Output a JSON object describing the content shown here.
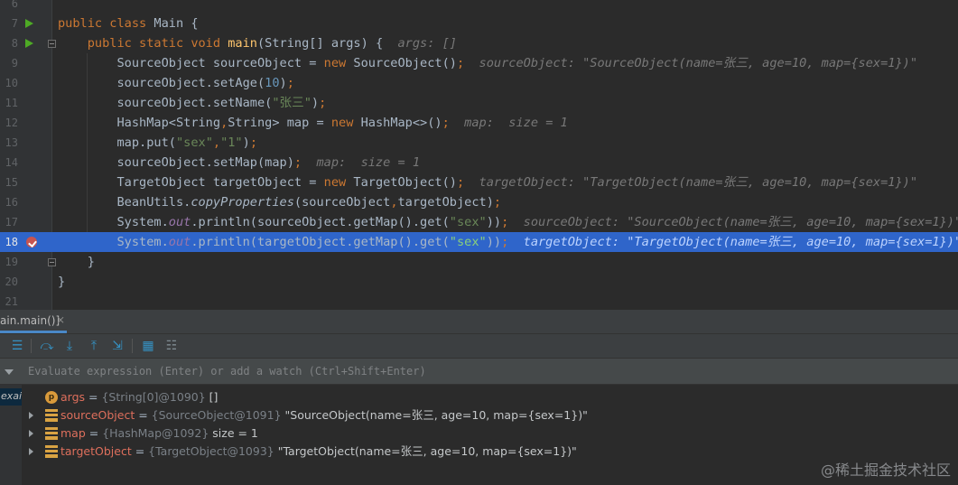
{
  "editor": {
    "lines": [
      {
        "n": "6",
        "tokens": []
      },
      {
        "n": "7",
        "tokens": [
          {
            "t": "public class ",
            "c": "kw"
          },
          {
            "t": "Main {",
            "c": ""
          }
        ]
      },
      {
        "n": "8",
        "tokens": [
          {
            "t": "    public static void ",
            "c": "kw"
          },
          {
            "t": "main",
            "c": "fn"
          },
          {
            "t": "(String[] args) {  ",
            "c": ""
          },
          {
            "t": "args: []",
            "c": "inl"
          }
        ]
      },
      {
        "n": "9",
        "tokens": [
          {
            "t": "        SourceObject sourceObject = ",
            "c": ""
          },
          {
            "t": "new ",
            "c": "kw"
          },
          {
            "t": "SourceObject()",
            "c": ""
          },
          {
            "t": ";",
            "c": "kw"
          },
          {
            "t": "  sourceObject: \"SourceObject(name=张三, age=10, map={sex=1})\"",
            "c": "inl"
          }
        ]
      },
      {
        "n": "10",
        "tokens": [
          {
            "t": "        sourceObject.setAge(",
            "c": ""
          },
          {
            "t": "10",
            "c": "num"
          },
          {
            "t": ")",
            "c": ""
          },
          {
            "t": ";",
            "c": "kw"
          }
        ]
      },
      {
        "n": "11",
        "tokens": [
          {
            "t": "        sourceObject.setName(",
            "c": ""
          },
          {
            "t": "\"张三\"",
            "c": "str"
          },
          {
            "t": ")",
            "c": ""
          },
          {
            "t": ";",
            "c": "kw"
          }
        ]
      },
      {
        "n": "12",
        "tokens": [
          {
            "t": "        HashMap<String",
            "c": ""
          },
          {
            "t": ",",
            "c": "kw"
          },
          {
            "t": "String> map = ",
            "c": ""
          },
          {
            "t": "new ",
            "c": "kw"
          },
          {
            "t": "HashMap<>()",
            "c": ""
          },
          {
            "t": ";",
            "c": "kw"
          },
          {
            "t": "  map:  size = 1",
            "c": "inl"
          }
        ]
      },
      {
        "n": "13",
        "tokens": [
          {
            "t": "        map.put(",
            "c": ""
          },
          {
            "t": "\"sex\"",
            "c": "str"
          },
          {
            "t": ",",
            "c": "kw"
          },
          {
            "t": "\"1\"",
            "c": "str"
          },
          {
            "t": ")",
            "c": ""
          },
          {
            "t": ";",
            "c": "kw"
          }
        ]
      },
      {
        "n": "14",
        "tokens": [
          {
            "t": "        sourceObject.setMap(map)",
            "c": ""
          },
          {
            "t": ";",
            "c": "kw"
          },
          {
            "t": "  map:  size = 1",
            "c": "inl"
          }
        ]
      },
      {
        "n": "15",
        "tokens": [
          {
            "t": "        TargetObject targetObject = ",
            "c": ""
          },
          {
            "t": "new ",
            "c": "kw"
          },
          {
            "t": "TargetObject()",
            "c": ""
          },
          {
            "t": ";",
            "c": "kw"
          },
          {
            "t": "  targetObject: \"TargetObject(name=张三, age=10, map={sex=1})\"",
            "c": "inl"
          }
        ]
      },
      {
        "n": "16",
        "tokens": [
          {
            "t": "        BeanUtils.",
            "c": ""
          },
          {
            "t": "copyProperties",
            "c": "ital"
          },
          {
            "t": "(sourceObject",
            "c": ""
          },
          {
            "t": ",",
            "c": "kw"
          },
          {
            "t": "targetObject)",
            "c": ""
          },
          {
            "t": ";",
            "c": "kw"
          }
        ]
      },
      {
        "n": "17",
        "tokens": [
          {
            "t": "        System.",
            "c": ""
          },
          {
            "t": "out",
            "c": "fld"
          },
          {
            "t": ".println(sourceObject.getMap().get(",
            "c": ""
          },
          {
            "t": "\"sex\"",
            "c": "str"
          },
          {
            "t": "))",
            "c": ""
          },
          {
            "t": ";",
            "c": "kw"
          },
          {
            "t": "  sourceObject: \"SourceObject(name=张三, age=10, map={sex=1})\"",
            "c": "inl"
          }
        ]
      },
      {
        "n": "18",
        "tokens": [
          {
            "t": "        System.",
            "c": ""
          },
          {
            "t": "out",
            "c": "fld"
          },
          {
            "t": ".println(targetObject.getMap().get(",
            "c": ""
          },
          {
            "t": "\"sex\"",
            "c": "str"
          },
          {
            "t": "))",
            "c": ""
          },
          {
            "t": ";",
            "c": "kw"
          },
          {
            "t": "  targetObject: \"TargetObject(name=张三, age=10, map={sex=1})\"",
            "c": "inl"
          }
        ]
      },
      {
        "n": "19",
        "tokens": [
          {
            "t": "    }",
            "c": ""
          }
        ]
      },
      {
        "n": "20",
        "tokens": [
          {
            "t": "}",
            "c": ""
          }
        ]
      },
      {
        "n": "21",
        "tokens": []
      }
    ]
  },
  "debugger": {
    "frame_tab": "ain.main()]",
    "frame_tab_close": "⨯",
    "toolbar": [
      {
        "name": "show-execution-point-icon",
        "glyph": "☰"
      },
      {
        "name": "step-over-icon",
        "glyph": "⤼"
      },
      {
        "name": "step-into-icon",
        "glyph": "⤓"
      },
      {
        "name": "step-out-icon",
        "glyph": "⤒"
      },
      {
        "name": "run-to-cursor-icon",
        "glyph": "⇲"
      },
      {
        "name": "evaluate-expression-icon",
        "glyph": "▦"
      },
      {
        "name": "trace-stream-icon",
        "glyph": "☷"
      }
    ],
    "watch_placeholder": "Evaluate expression (Enter) or add a watch (Ctrl+Shift+Enter)",
    "frame_item": "exai",
    "variables": [
      {
        "kind": "param",
        "icon": "p",
        "name": "args",
        "type": "{String[0]@1090}",
        "value": "[]",
        "expandable": false
      },
      {
        "kind": "field",
        "name": "sourceObject",
        "type": "{SourceObject@1091}",
        "value": "\"SourceObject(name=张三, age=10, map={sex=1})\"",
        "expandable": true
      },
      {
        "kind": "field",
        "name": "map",
        "type": "{HashMap@1092}",
        "value": " size = 1",
        "expandable": true
      },
      {
        "kind": "field",
        "name": "targetObject",
        "type": "{TargetObject@1093}",
        "value": "\"TargetObject(name=张三, age=10, map={sex=1})\"",
        "expandable": true
      }
    ],
    "equals": " = "
  },
  "watermark": "@稀土掘金技术社区",
  "colors": {
    "highlight": "#2f65ca",
    "keyword": "#cc7832",
    "string": "#6a8759",
    "number": "#6897bb",
    "breakpoint": "#c75450",
    "run": "#4eaa25"
  }
}
